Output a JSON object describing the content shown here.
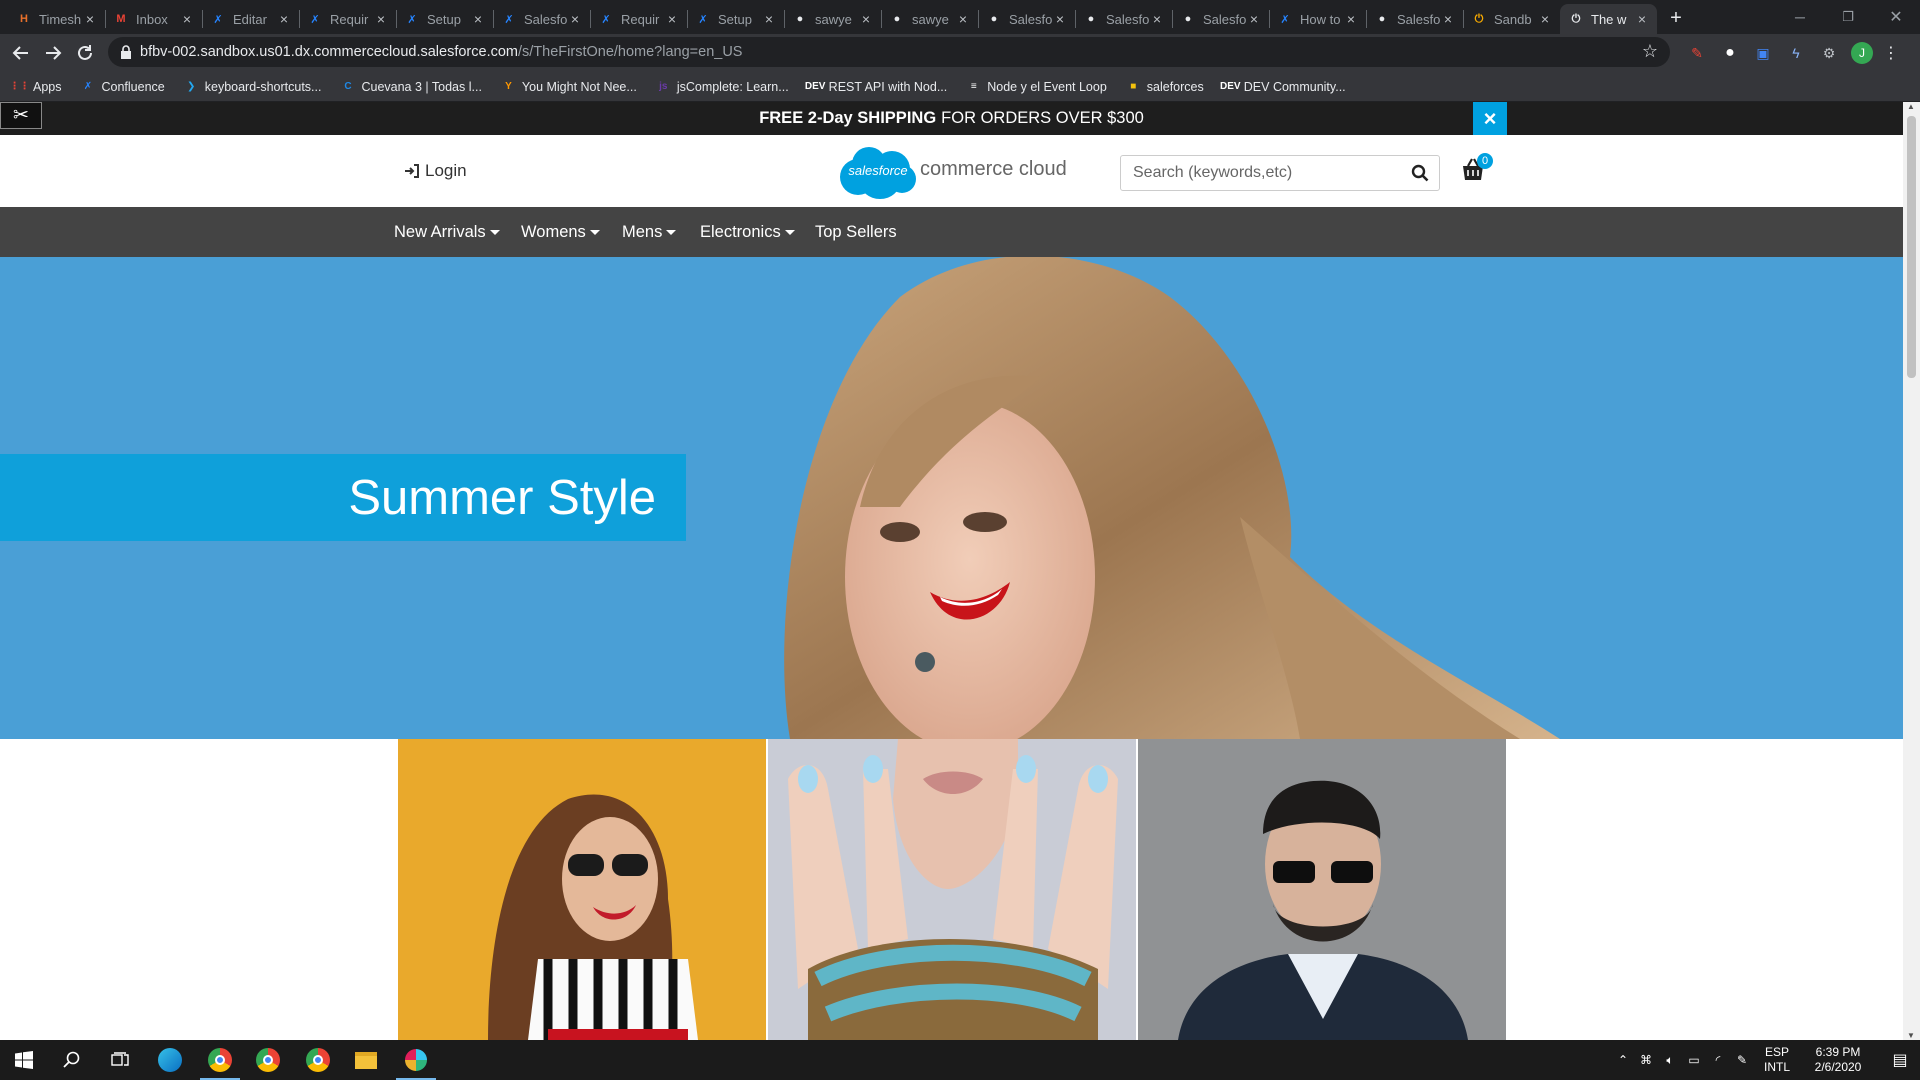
{
  "browser": {
    "tabs": [
      {
        "title": "Timesh",
        "favicon": "hubstaff-icon",
        "color": "#e8702a",
        "glyph": "H"
      },
      {
        "title": "Inbox",
        "favicon": "gmail-icon",
        "color": "#ea4335",
        "glyph": "M"
      },
      {
        "title": "Editar",
        "favicon": "confluence-icon",
        "color": "#2684ff",
        "glyph": "✗"
      },
      {
        "title": "Requir",
        "favicon": "confluence-icon",
        "color": "#2684ff",
        "glyph": "✗"
      },
      {
        "title": "Setup",
        "favicon": "confluence-icon",
        "color": "#2684ff",
        "glyph": "✗"
      },
      {
        "title": "Salesfo",
        "favicon": "confluence-icon",
        "color": "#2684ff",
        "glyph": "✗"
      },
      {
        "title": "Requir",
        "favicon": "confluence-icon",
        "color": "#2684ff",
        "glyph": "✗"
      },
      {
        "title": "Setup",
        "favicon": "confluence-icon",
        "color": "#2684ff",
        "glyph": "✗"
      },
      {
        "title": "sawye",
        "favicon": "github-icon",
        "color": "#e8eaed",
        "glyph": "●"
      },
      {
        "title": "sawye",
        "favicon": "github-icon",
        "color": "#e8eaed",
        "glyph": "●"
      },
      {
        "title": "Salesfo",
        "favicon": "github-icon",
        "color": "#e8eaed",
        "glyph": "●"
      },
      {
        "title": "Salesfo",
        "favicon": "github-icon",
        "color": "#e8eaed",
        "glyph": "●"
      },
      {
        "title": "Salesfo",
        "favicon": "github-icon",
        "color": "#e8eaed",
        "glyph": "●"
      },
      {
        "title": "How to",
        "favicon": "confluence-icon",
        "color": "#2684ff",
        "glyph": "✗"
      },
      {
        "title": "Salesfo",
        "favicon": "github-icon",
        "color": "#e8eaed",
        "glyph": "●"
      },
      {
        "title": "Sandb",
        "favicon": "power-icon",
        "color": "#f9ab00",
        "glyph": "⏻"
      },
      {
        "title": "The w",
        "favicon": "power-icon",
        "color": "#e8eaed",
        "glyph": "⏻",
        "active": true
      }
    ],
    "new_tab": "+",
    "url_host": "bfbv-002.sandbox.us01.dx.commercecloud.salesforce.com",
    "url_path": "/s/TheFirstOne/home?lang=en_US",
    "profile_initial": "J",
    "bookmarks": [
      {
        "label": "Apps",
        "icon": "apps-grid-icon",
        "color": "#ea4335",
        "glyph": "⋮⋮"
      },
      {
        "label": "Confluence",
        "icon": "confluence-icon",
        "color": "#2684ff",
        "glyph": "✗"
      },
      {
        "label": "keyboard-shortcuts...",
        "icon": "vscode-icon",
        "color": "#23a9f2",
        "glyph": "❯"
      },
      {
        "label": "Cuevana 3 | Todas l...",
        "icon": "cuevana-icon",
        "color": "#1e88e5",
        "glyph": "C"
      },
      {
        "label": "You Might Not Nee...",
        "icon": "hn-icon",
        "color": "#ff9800",
        "glyph": "Y"
      },
      {
        "label": "jsComplete: Learn...",
        "icon": "js-icon",
        "color": "#6a3aa8",
        "glyph": "js"
      },
      {
        "label": "REST API with Nod...",
        "icon": "dev-icon",
        "color": "#ffffff",
        "glyph": "DEV"
      },
      {
        "label": "Node y el Event Loop",
        "icon": "doc-icon",
        "color": "#ffffff",
        "glyph": "≡"
      },
      {
        "label": "saleforces",
        "icon": "folder-icon",
        "color": "#f4c20d",
        "glyph": "■"
      },
      {
        "label": "DEV Community...",
        "icon": "dev-icon",
        "color": "#ffffff",
        "glyph": "DEV"
      }
    ]
  },
  "site": {
    "promo_bold": "FREE 2-Day SHIPPING",
    "promo_rest": "FOR ORDERS OVER $300",
    "promo_close": "×",
    "login_label": "Login",
    "logo_cloud_text": "salesforce",
    "logo_text": "commerce cloud",
    "search_placeholder": "Search (keywords,etc)",
    "cart_count": "0",
    "nav": [
      {
        "label": "New Arrivals",
        "dropdown": true
      },
      {
        "label": "Womens",
        "dropdown": true
      },
      {
        "label": "Mens",
        "dropdown": true
      },
      {
        "label": "Electronics",
        "dropdown": true
      },
      {
        "label": "Top Sellers",
        "dropdown": false
      }
    ],
    "hero_title": "Summer Style",
    "tiles": [
      "woman-sunglasses-tile",
      "nails-bracelet-tile",
      "man-sunglasses-tile"
    ]
  },
  "taskbar": {
    "lang_line1": "ESP",
    "lang_line2": "INTL",
    "time": "6:39 PM",
    "date": "2/6/2020",
    "accent": "#76b9ed"
  }
}
